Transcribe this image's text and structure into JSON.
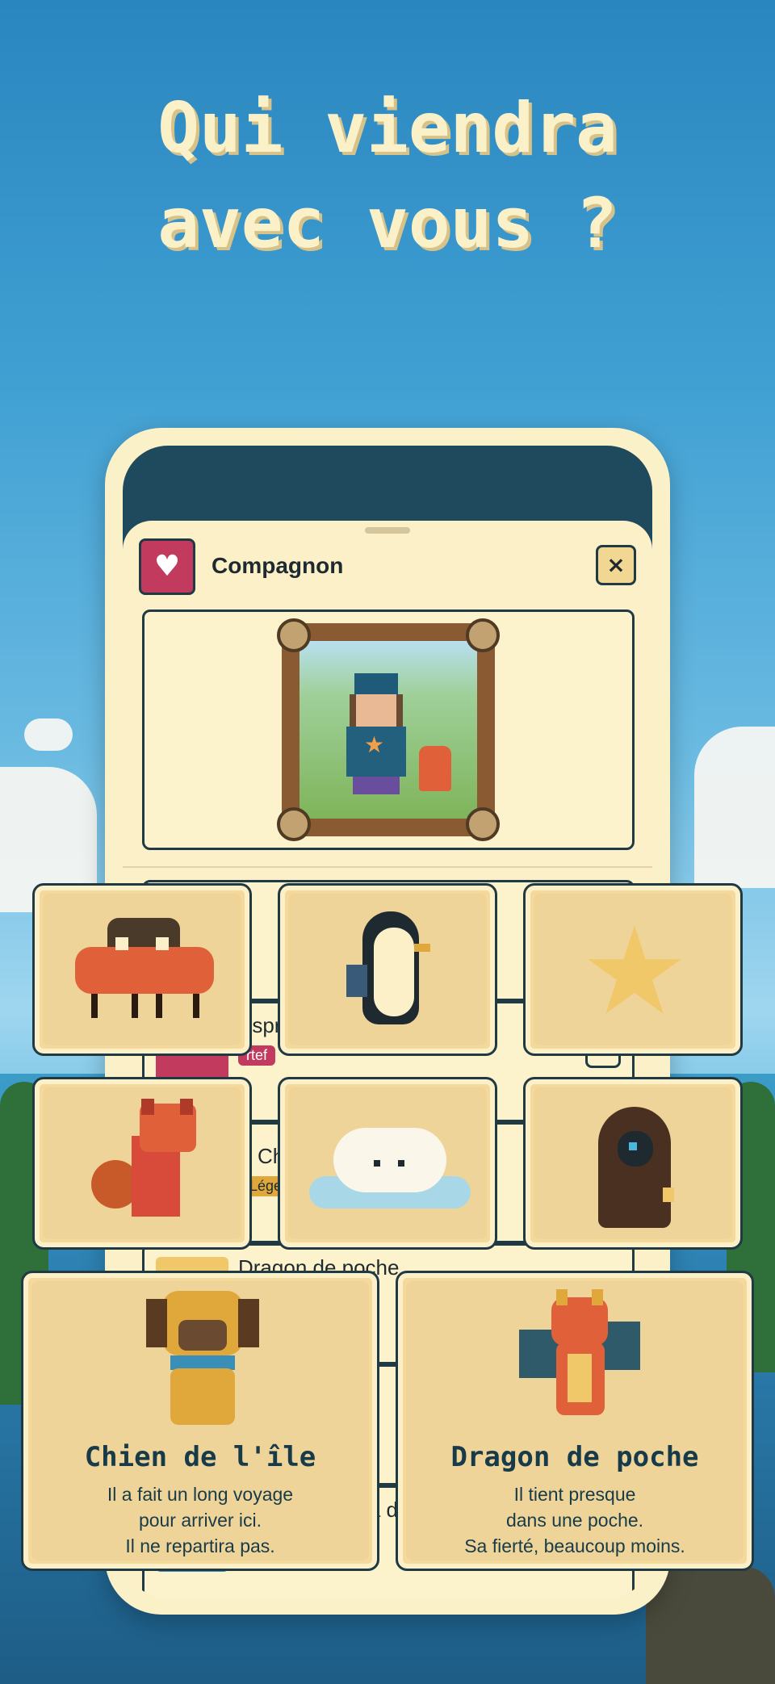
{
  "headline": {
    "line1": "Qui viendra",
    "line2": "avec vous ?"
  },
  "sheet": {
    "title": "Compagnon",
    "close_label": "×",
    "heart_icon": "heart-icon"
  },
  "list": [
    {
      "name": "Esprit-lanterne",
      "tag": "rtef"
    },
    {
      "name": "Chie",
      "tag": "Légen"
    },
    {
      "name": "Dragon de poche",
      "tag": ""
    },
    {
      "name": "Crabe au sac à dos",
      "tag": ""
    }
  ],
  "companions_small": [
    {
      "id": "crab",
      "icon": "crab-icon"
    },
    {
      "id": "penguin",
      "icon": "penguin-icon"
    },
    {
      "id": "star",
      "icon": "star-creature-icon"
    },
    {
      "id": "fox",
      "icon": "fox-icon"
    },
    {
      "id": "cloud-cat",
      "icon": "cloud-cat-icon"
    },
    {
      "id": "hooded-spirit",
      "icon": "hooded-spirit-icon"
    }
  ],
  "featured": [
    {
      "name": "Chien de l'île",
      "desc1": "Il a fait un long voyage",
      "desc2": "pour arriver ici.",
      "desc3": "Il ne repartira pas."
    },
    {
      "name": "Dragon de poche",
      "desc1": "Il tient presque",
      "desc2": "dans une poche.",
      "desc3": "Sa fierté, beaucoup moins."
    }
  ],
  "colors": {
    "accent": "#c23a5e",
    "ink": "#173b48",
    "cream": "#fbf0c8",
    "tile": "#f5d99a"
  }
}
